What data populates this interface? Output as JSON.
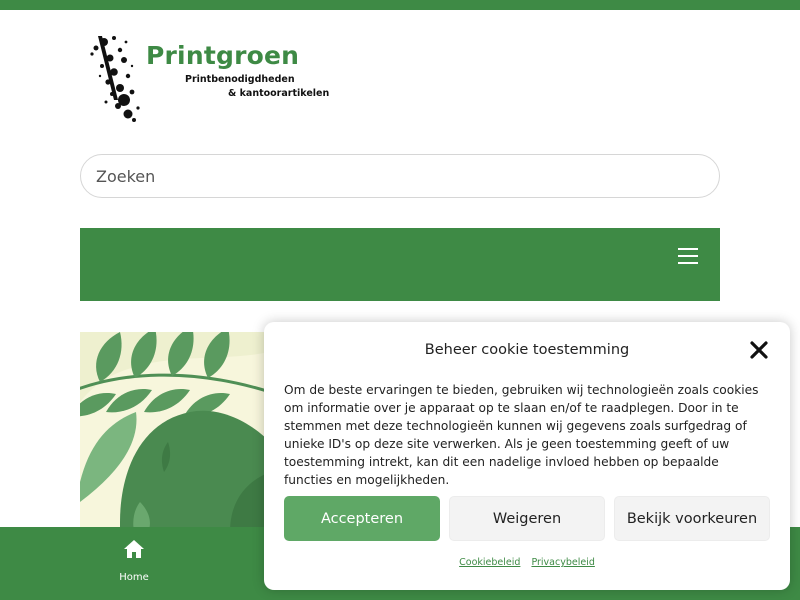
{
  "brand": {
    "name": "Printgroen",
    "tagline_line1": "Printbenodigdheden",
    "tagline_line2": "& kantoorartikelen",
    "accent_color": "#3e8a45"
  },
  "search": {
    "placeholder": "Zoeken",
    "value": ""
  },
  "nav": {
    "menu_icon": "hamburger-menu-icon"
  },
  "bottom_nav": {
    "items": [
      {
        "label": "Home",
        "icon": "home-icon"
      }
    ]
  },
  "cookie_dialog": {
    "title": "Beheer cookie toestemming",
    "close_icon": "close-icon",
    "body": "Om de beste ervaringen te bieden, gebruiken wij technologieën zoals cookies om informatie over je apparaat op te slaan en/of te raadplegen. Door in te stemmen met deze technologieën kunnen wij gegevens zoals surfgedrag of unieke ID's op deze site verwerken. Als je geen toestemming geeft of uw toestemming intrekt, kan dit een nadelige invloed hebben op bepaalde functies en mogelijkheden.",
    "buttons": {
      "accept": "Accepteren",
      "deny": "Weigeren",
      "preferences": "Bekijk voorkeuren"
    },
    "links": {
      "cookie_policy": "Cookiebeleid",
      "privacy_policy": "Privacybeleid"
    }
  }
}
